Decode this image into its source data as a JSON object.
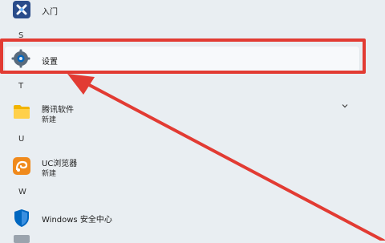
{
  "items": {
    "rumen": {
      "label": "入门"
    },
    "section_s": "S",
    "settings": {
      "label": "设置"
    },
    "section_t": "T",
    "tencent": {
      "label": "腾讯软件",
      "sub": "新建"
    },
    "section_u": "U",
    "uc": {
      "label": "UC浏览器",
      "sub": "新建"
    },
    "section_w": "W",
    "windows_security": {
      "label": "Windows 安全中心"
    }
  },
  "colors": {
    "background": "#e9eef2",
    "highlight": "#e23b33",
    "settings_gear": "#0067c0",
    "folder": "#f2b400",
    "uc_orange": "#f08a1c",
    "shield_blue": "#0067c0"
  },
  "icons": {
    "rumen": "x-icon",
    "settings": "gear-icon",
    "tencent": "folder-icon",
    "uc": "uc-browser-icon",
    "windows_security": "shield-icon",
    "expand": "chevron-down-icon"
  }
}
